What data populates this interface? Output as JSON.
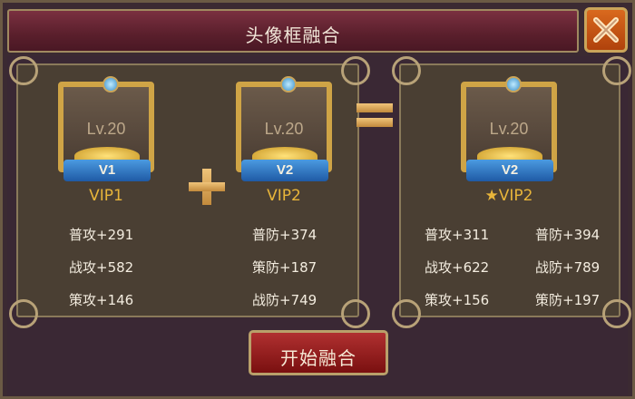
{
  "dialog": {
    "title": "头像框融合",
    "close_icon": "close-x-icon"
  },
  "left_card": {
    "frames": [
      {
        "level": "Lv.20",
        "ribbon": "V1",
        "vip": "VIP1"
      },
      {
        "level": "Lv.20",
        "ribbon": "V2",
        "vip": "VIP2"
      }
    ],
    "stats_col1": [
      "普攻+291",
      "战攻+582",
      "策攻+146"
    ],
    "stats_col2": [
      "普防+374",
      "策防+187",
      "战防+749"
    ]
  },
  "right_card": {
    "frame": {
      "level": "Lv.20",
      "ribbon": "V2",
      "vip": "★VIP2"
    },
    "stats_col1": [
      "普攻+311",
      "战攻+622",
      "策攻+156"
    ],
    "stats_col2": [
      "普防+394",
      "战防+789",
      "策防+197"
    ]
  },
  "operators": {
    "plus": "plus-icon",
    "equals": "equals-icon"
  },
  "actions": {
    "start_label": "开始融合"
  },
  "colors": {
    "accent": "#e8b53a",
    "title_bar": "#5a1f2c",
    "button": "#9b1f1f"
  }
}
